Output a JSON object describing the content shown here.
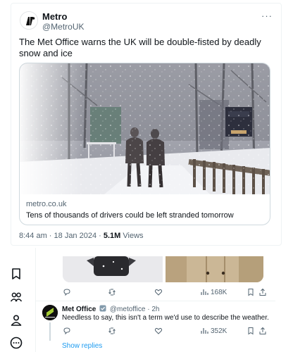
{
  "tweet": {
    "author_name": "Metro",
    "author_handle": "@MetroUK",
    "more_label": "···",
    "text": "The Met Office warns the UK will be double-fisted by deadly snow and ice",
    "link_card": {
      "domain": "metro.co.uk",
      "title": "Tens of thousands of drivers could be left stranded tomorrow"
    },
    "timestamp": "8:44 am · 18 Jan 2024 · ",
    "views_count": "5.1M",
    "views_label": " Views"
  },
  "left_rail": {
    "icons": [
      "bookmark-icon",
      "communities-icon",
      "profile-icon",
      "more-circle-icon"
    ]
  },
  "upper_actions": {
    "views": "168K"
  },
  "reply": {
    "author_name": "Met Office",
    "author_handle": "@metoffice",
    "separator": " · ",
    "time": "2h",
    "text": "Needless to say, this isn't a term we'd use to describe the weather.",
    "views": "352K",
    "avatar_label": "Met Office"
  },
  "show_replies_label": "Show replies",
  "colors": {
    "text_primary": "#0f1419",
    "text_secondary": "#536471",
    "link_blue": "#1d9bf0",
    "border": "#cfd9de"
  }
}
